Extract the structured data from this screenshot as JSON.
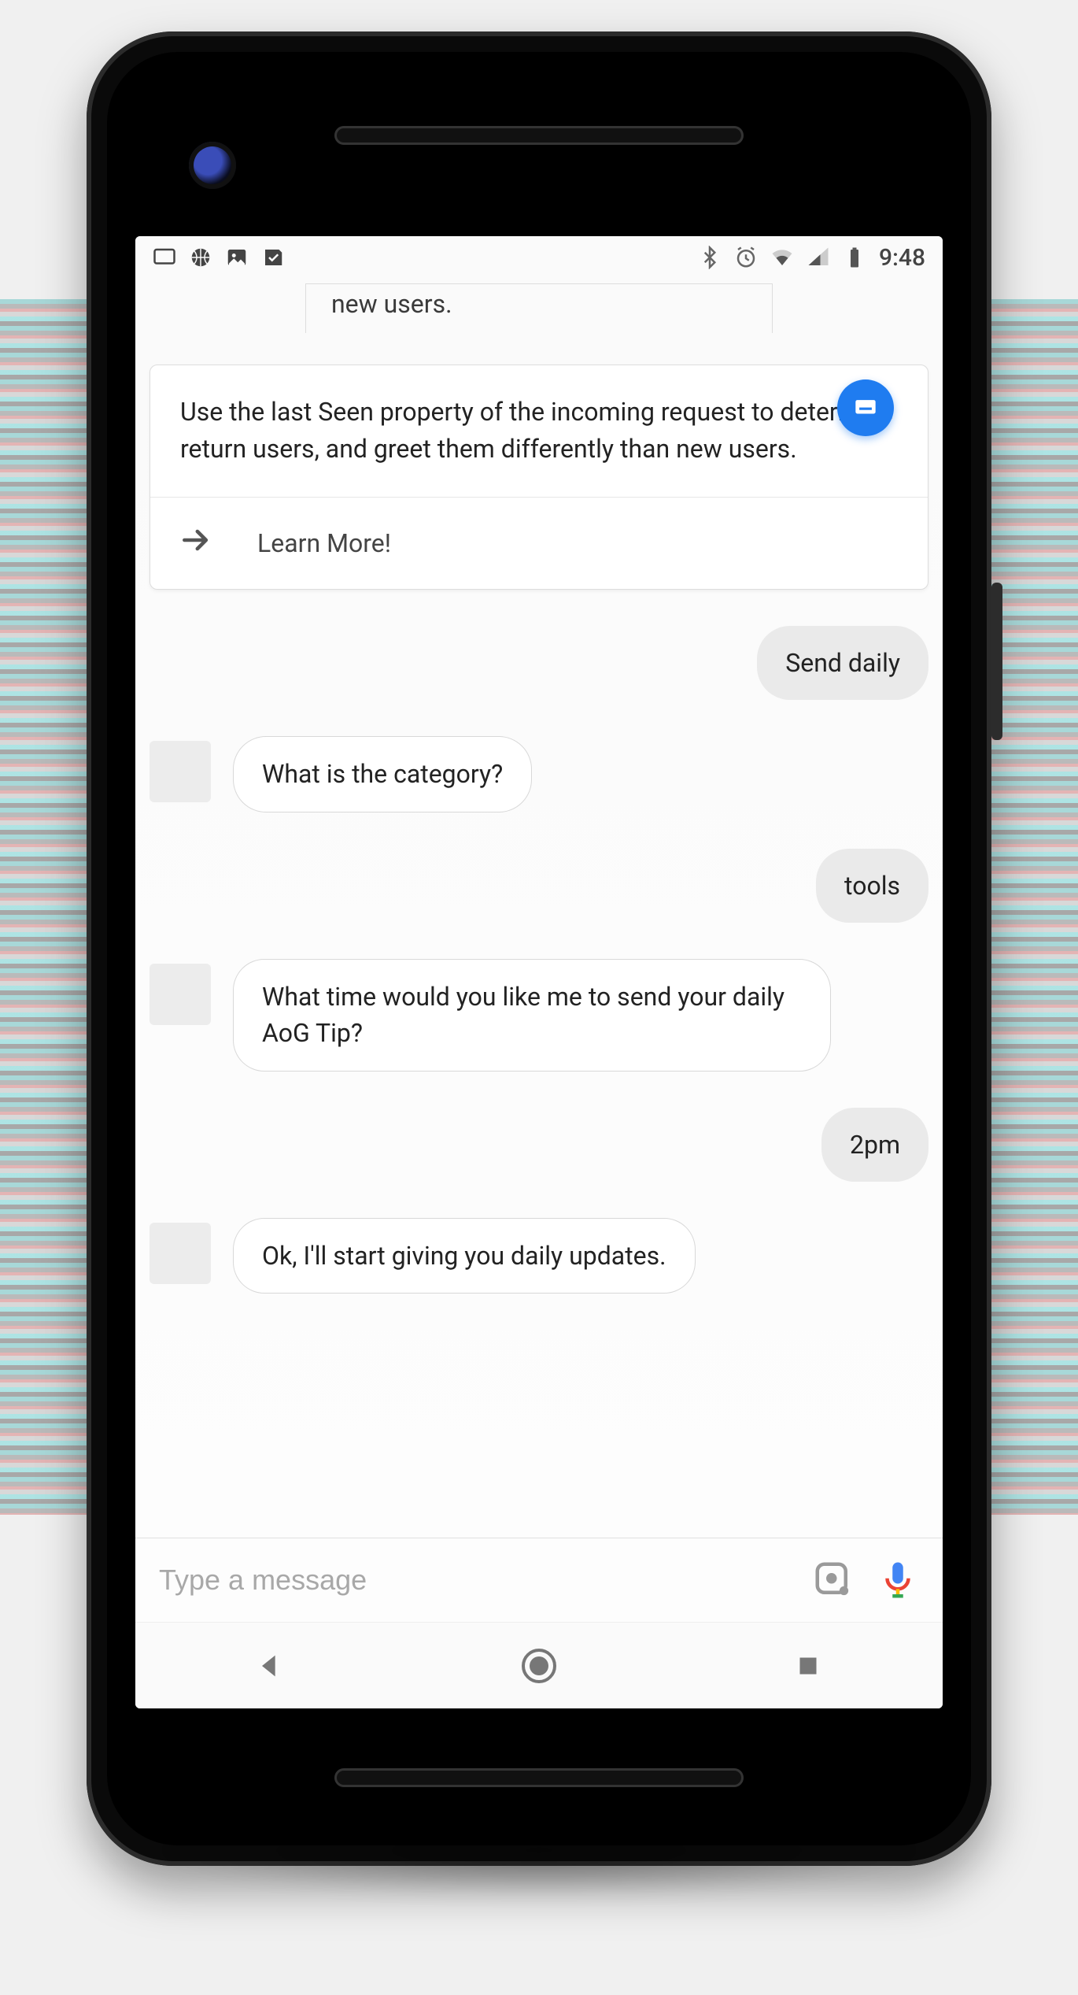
{
  "status": {
    "time": "9:48",
    "icons_left": [
      "cast-icon",
      "basketball-icon",
      "image-icon",
      "check-icon"
    ],
    "icons_right": [
      "bluetooth-icon",
      "alarm-icon",
      "wifi-icon",
      "cell-icon",
      "battery-icon"
    ]
  },
  "card_stub_text": "new users.",
  "card": {
    "body": "Use the last Seen property of the incoming request to determine return users, and greet them differently than new users.",
    "action_label": "Learn More!"
  },
  "messages": [
    {
      "role": "user",
      "text": "Send daily"
    },
    {
      "role": "bot",
      "text": "What is the category?"
    },
    {
      "role": "user",
      "text": "tools"
    },
    {
      "role": "bot",
      "text": "What time would you like me to send your daily AoG Tip?"
    },
    {
      "role": "user",
      "text": "2pm"
    },
    {
      "role": "bot",
      "text": "Ok, I'll start giving you daily updates."
    }
  ],
  "input": {
    "placeholder": "Type a message"
  },
  "colors": {
    "accent": "#1f7cf0"
  }
}
